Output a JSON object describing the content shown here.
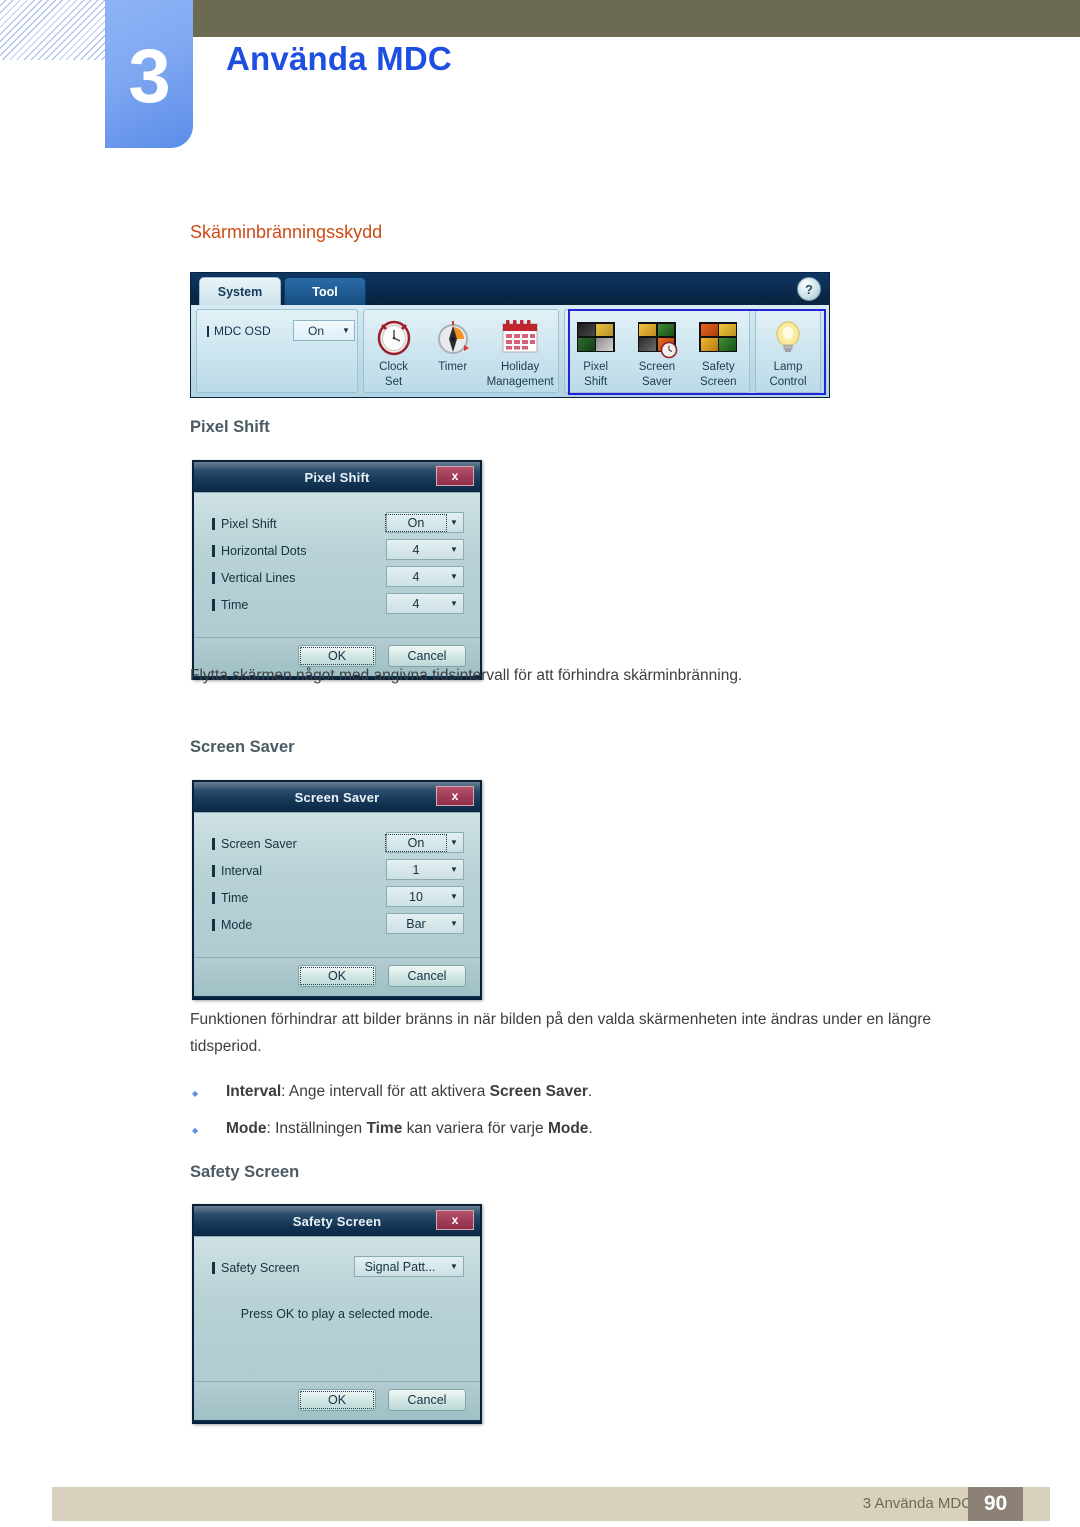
{
  "header": {
    "chapter_number": "3",
    "chapter_title": "Använda MDC"
  },
  "content": {
    "section_heading": "Skärminbränningsskydd",
    "sub_pixel_shift": "Pixel Shift",
    "para_pixel_shift": "Flytta skärmen något med angivna tidsintervall för att förhindra skärminbränning.",
    "sub_screen_saver": "Screen Saver",
    "para_screen_saver": "Funktionen förhindrar att bilder bränns in när bilden på den valda skärmenheten inte ändras under en längre tidsperiod.",
    "bullets": [
      {
        "parts": [
          {
            "text": "Interval",
            "bold": true
          },
          {
            "text": ": Ange intervall för att aktivera ",
            "bold": false
          },
          {
            "text": "Screen Saver",
            "bold": true
          },
          {
            "text": ".",
            "bold": false
          }
        ]
      },
      {
        "parts": [
          {
            "text": "Mode",
            "bold": true
          },
          {
            "text": ": Inställningen ",
            "bold": false
          },
          {
            "text": "Time",
            "bold": true
          },
          {
            "text": " kan variera för varje ",
            "bold": false
          },
          {
            "text": "Mode",
            "bold": true
          },
          {
            "text": ".",
            "bold": false
          }
        ]
      }
    ],
    "sub_safety_screen": "Safety Screen"
  },
  "mdc_toolbar": {
    "tabs": [
      {
        "label": "System",
        "active": true
      },
      {
        "label": "Tool",
        "active": false
      }
    ],
    "help_label": "?",
    "osd": {
      "label": "MDC OSD",
      "value": "On",
      "arrow": "▼"
    },
    "groups": [
      {
        "name": "clock-group",
        "icons": [
          {
            "label_line1": "Clock",
            "label_line2": "Set",
            "icon": "alarm-clock-icon"
          },
          {
            "label_line1": "Timer",
            "label_line2": "",
            "icon": "timer-icon"
          },
          {
            "label_line1": "Holiday",
            "label_line2": "Management",
            "icon": "calendar-icon"
          }
        ]
      },
      {
        "name": "screen-protection-group",
        "highlighted": true,
        "icons": [
          {
            "label_line1": "Pixel",
            "label_line2": "Shift",
            "icon": "pixel-shift-icon"
          },
          {
            "label_line1": "Screen",
            "label_line2": "Saver",
            "icon": "screen-saver-icon"
          },
          {
            "label_line1": "Safety",
            "label_line2": "Screen",
            "icon": "safety-screen-icon"
          }
        ]
      },
      {
        "name": "lamp-group",
        "icons": [
          {
            "label_line1": "Lamp",
            "label_line2": "Control",
            "icon": "lightbulb-icon"
          }
        ]
      }
    ]
  },
  "dialog_pixel_shift": {
    "title": "Pixel Shift",
    "close_label": "x",
    "rows": [
      {
        "label": "Pixel Shift",
        "value": "On",
        "focused": true
      },
      {
        "label": "Horizontal Dots",
        "value": "4",
        "focused": false
      },
      {
        "label": "Vertical Lines",
        "value": "4",
        "focused": false
      },
      {
        "label": "Time",
        "value": "4",
        "focused": false
      }
    ],
    "ok_label": "OK",
    "cancel_label": "Cancel"
  },
  "dialog_screen_saver": {
    "title": "Screen Saver",
    "close_label": "x",
    "rows": [
      {
        "label": "Screen Saver",
        "value": "On",
        "focused": true
      },
      {
        "label": "Interval",
        "value": "1",
        "focused": false
      },
      {
        "label": "Time",
        "value": "10",
        "focused": false
      },
      {
        "label": "Mode",
        "value": "Bar",
        "focused": false
      }
    ],
    "ok_label": "OK",
    "cancel_label": "Cancel"
  },
  "dialog_safety_screen": {
    "title": "Safety Screen",
    "close_label": "x",
    "rows": [
      {
        "label": "Safety Screen",
        "value": "Signal Patt...",
        "focused": false
      }
    ],
    "note": "Press OK to play a selected mode.",
    "ok_label": "OK",
    "cancel_label": "Cancel"
  },
  "footer": {
    "text": "3 Använda MDC",
    "page": "90"
  },
  "colors": {
    "accent_heading": "#cc4a16",
    "chapter_title": "#1f4fe0",
    "olive_band": "#6c6a53",
    "chapter_box": "#7fa8f2",
    "footer_band": "#d7d1bd",
    "footer_page_box": "#8d8075",
    "highlight_border": "#2323d8"
  }
}
